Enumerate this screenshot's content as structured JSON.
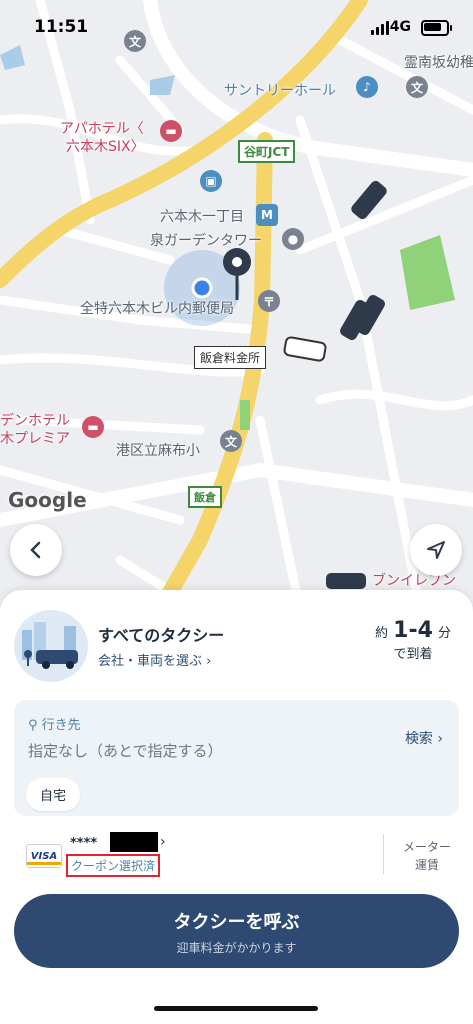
{
  "status": {
    "time": "11:51",
    "network": "4G"
  },
  "map": {
    "labels": {
      "reinanzaka": "霊南坂幼稚",
      "suntory": "サントリーホール",
      "apa_hotel": "アパホテル〈",
      "apa_hotel_2": "六本木SIX〉",
      "tanimachi_jct": "谷町JCT",
      "roppongi1": "六本木一丁目",
      "izumi_tower": "泉ガーデンタワー",
      "post_office": "全特六本木ビル内郵便局",
      "iikura_toll": "飯倉料金所",
      "garden_hotel": "デンホテル",
      "garden_hotel_2": "木プレミア",
      "azabu_school": "港区立麻布小",
      "iikura": "飯倉",
      "eleven": "ブンイレブン",
      "google": "Google"
    }
  },
  "sheet": {
    "title": "すべてのタクシー",
    "subtitle": "会社・車両を選ぶ",
    "eta_prefix": "約",
    "eta_value": "1-4",
    "eta_unit": "分",
    "eta_suffix": "で到着",
    "destination_label": "行き先",
    "destination_placeholder": "指定なし（あとで指定する）",
    "search_label": "検索",
    "home_chip": "自宅",
    "card_brand": "VISA",
    "card_number": "****",
    "coupon": "クーポン選択済",
    "meter_line1": "メーター",
    "meter_line2": "運賃",
    "call_button": "タクシーを呼ぶ",
    "call_note": "迎車料金がかかります"
  },
  "colors": {
    "accent": "#2f4a72",
    "highway": "#f5d46a",
    "coupon_border": "#e0262b"
  }
}
